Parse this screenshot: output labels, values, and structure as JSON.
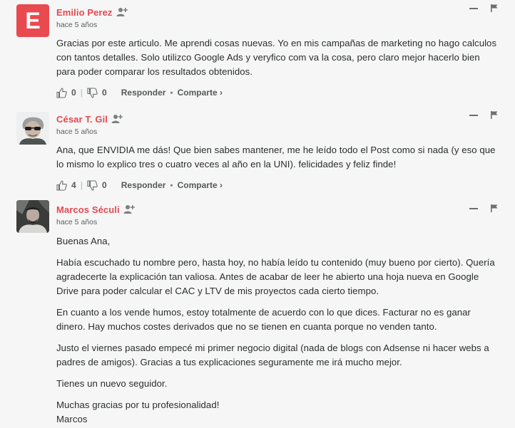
{
  "colors": {
    "author": "#e5494f",
    "avatar_letter_bg": "#e84a4f",
    "text": "#2a2e2e",
    "meta": "#5a5e5e"
  },
  "comments": [
    {
      "author": "Emilio Perez",
      "avatar_letter": "E",
      "time": "hace 5 años",
      "paragraphs": [
        "Gracias por este articulo. Me aprendi cosas nuevas. Yo en mis campañas de marketing no hago calculos con tantos detalles. Solo utilizco Google Ads y veryfico com va la cosa, pero claro mejor hacerlo bien para poder comparar los resultados obtenidos."
      ],
      "upvotes": "0",
      "downvotes": "0",
      "reply_label": "Responder",
      "share_label": "Comparte ›"
    },
    {
      "author": "César T. Gil",
      "time": "hace 5 años",
      "paragraphs": [
        "Ana, que ENVIDIA me dás! Que bien sabes mantener, me he leído todo el Post como si nada (y eso que lo mismo lo explico tres o cuatro veces al año en la UNI). felicidades y feliz finde!"
      ],
      "upvotes": "4",
      "downvotes": "0",
      "reply_label": "Responder",
      "share_label": "Comparte ›"
    },
    {
      "author": "Marcos Séculi",
      "time": "hace 5 años",
      "paragraphs": [
        "Buenas Ana,",
        "Había escuchado tu nombre pero, hasta hoy, no había leído tu contenido (muy bueno por cierto). Quería agradecerte la explicación tan valiosa. Antes de acabar de leer he abierto una hoja nueva en Google Drive para poder calcular el CAC y LTV de mis proyectos cada cierto tiempo.",
        "En cuanto a los vende humos, estoy totalmente de acuerdo con lo que dices. Facturar no es ganar dinero. Hay muchos costes derivados que no se tienen en cuanta porque no venden tanto.",
        "Justo el viernes pasado empecé mi primer negocio digital (nada de blogs con Adsense ni hacer webs a padres de amigos). Gracias a tus explicaciones seguramente me irá mucho mejor.",
        "Tienes un nuevo seguidor.",
        "Muchas gracias por tu profesionalidad!",
        "Marcos"
      ]
    }
  ]
}
